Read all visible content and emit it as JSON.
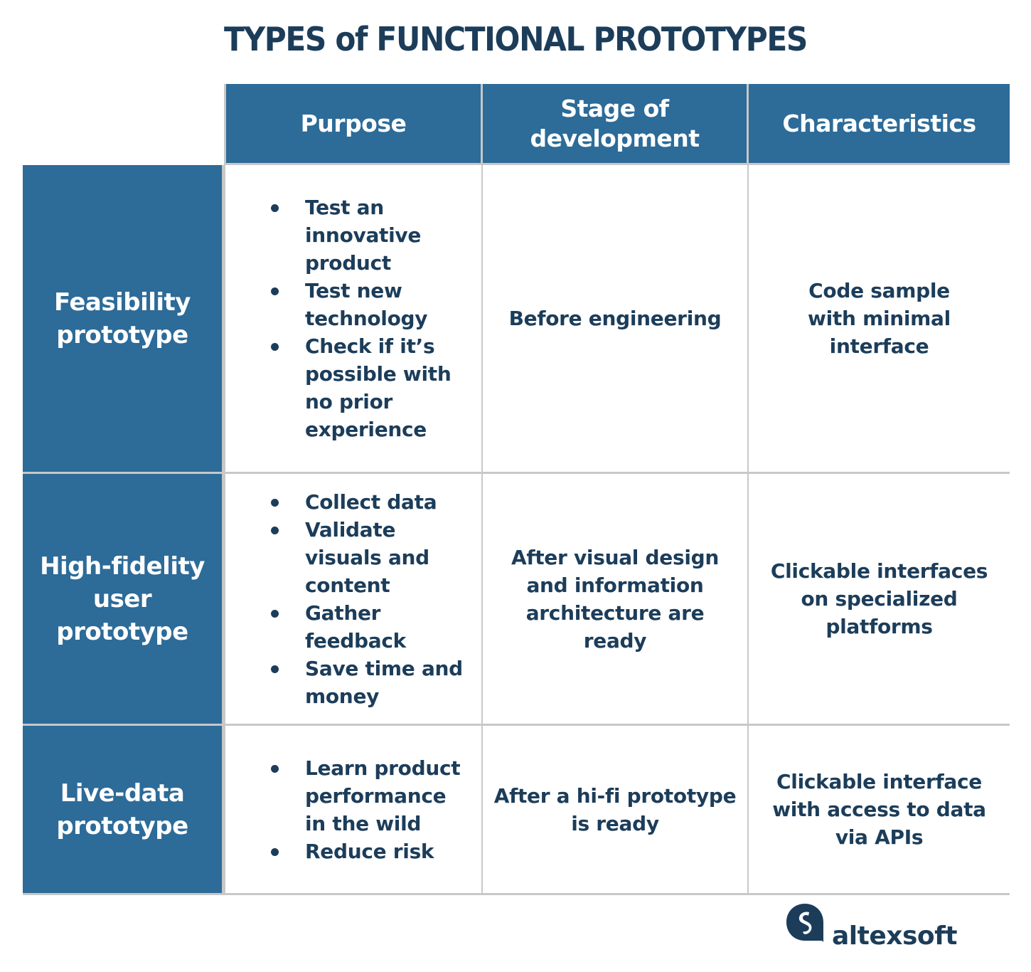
{
  "title": "TYPES of FUNCTIONAL PROTOTYPES",
  "columns": [
    "Purpose",
    "Stage of development",
    "Characteristics"
  ],
  "rows": [
    {
      "label": "Feasibility prototype",
      "purpose": [
        "Test an innovative product",
        "Test new technology",
        "Check if it’s possible with no prior experience"
      ],
      "stage": "Before engineering",
      "characteristics": "Code sample with minimal interface"
    },
    {
      "label": "High-fidelity user prototype",
      "purpose": [
        "Collect data",
        "Validate visuals and content",
        "Gather feedback",
        "Save time and money"
      ],
      "stage": "After visual design and information architecture are ready",
      "characteristics": "Clickable interfaces on specialized platforms"
    },
    {
      "label": "Live-data prototype",
      "purpose": [
        "Learn product performance in the wild",
        "Reduce risk"
      ],
      "stage": "After a hi-fi prototype is ready",
      "characteristics": "Clickable interface with access to data via APIs"
    }
  ],
  "logo": {
    "name": "altexsoft",
    "icon": "altexsoft-logo-icon"
  },
  "colors": {
    "header_bg": "#2d6b98",
    "text": "#1c3d5a",
    "grid": "#c8c8c8"
  }
}
